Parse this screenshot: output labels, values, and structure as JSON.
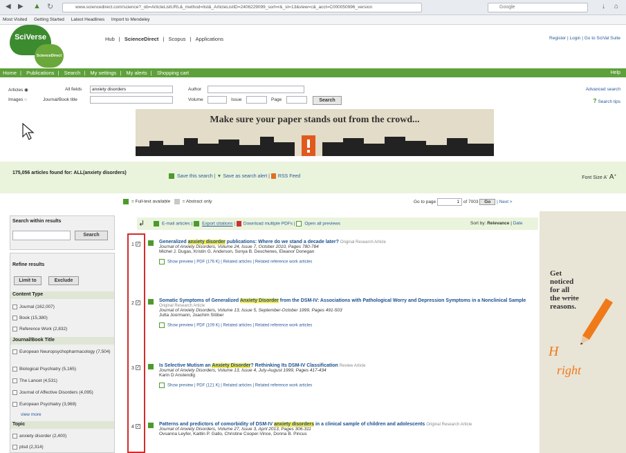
{
  "browser": {
    "url": "www.sciencedirect.com/science?_ob=ArticleListURL&_method=list&_ArticleListID=2406229099_sort=r&_st=13&view=c&_acct=C000050996_version",
    "search_engine": "Google",
    "bookmarks": [
      "Most Visited",
      "Getting Started",
      "Latest Headlines",
      "Import to Mendeley"
    ]
  },
  "header": {
    "logo_main": "SciVerse",
    "logo_sub": "ScienceDirect",
    "topnav": [
      "Hub",
      "ScienceDirect",
      "Scopus",
      "Applications"
    ],
    "right_links": "Register | Login | Go to SciVal Suite"
  },
  "greenbar": {
    "items": [
      "Home",
      "|",
      "Publications",
      "|",
      "Search",
      "|",
      "My settings",
      "|",
      "My alerts",
      "|",
      "Shopping cart"
    ],
    "help": "Help"
  },
  "search_form": {
    "articles_label": "Articles",
    "images_label": "Images",
    "allfields_label": "All fields",
    "allfields_value": "anxiety disorders",
    "journal_label": "Journal/Book title",
    "author_label": "Author",
    "volume_label": "Volume",
    "issue_label": "Issue",
    "page_label": "Page",
    "search_button": "Search",
    "advanced": "Advanced search",
    "tips": "Search tips"
  },
  "ad": {
    "headline": "Make sure your paper stands out from the crowd..."
  },
  "info": {
    "count_prefix": "175,056 articles found for: ALL(",
    "count_query": "anxiety disorders",
    "count_suffix": ")",
    "save_search": "Save this search",
    "save_alert": "Save as search alert",
    "rss": "RSS Feed",
    "font_size": "Font Size"
  },
  "legend": {
    "fulltext": "= Full-text available",
    "abstract": "= Abstract only",
    "goto_label": "Go to page",
    "page_value": "1",
    "of_pages": "of 7003",
    "go": "Go",
    "next": "| Next >"
  },
  "sidebar": {
    "search_within": "Search within results",
    "search_btn": "Search",
    "refine": "Refine results",
    "limit": "Limit to",
    "exclude": "Exclude",
    "content_type": "Content Type",
    "content_items": [
      "Journal (162,007)",
      "Book (15,380)",
      "Reference Work (2,832)"
    ],
    "journal_title": "Journal/Book Title",
    "journal_items": [
      "European Neuropsychopharmacology (7,504)",
      "Biological Psychiatry (5,165)",
      "The Lancet (4,531)",
      "Journal of Affective Disorders (4,095)",
      "European Psychiatry (3,969)"
    ],
    "view_more": "view more",
    "topic": "Topic",
    "topic_items": [
      "anxiety disorder (2,400)",
      "ptsd (2,314)"
    ]
  },
  "results_bar": {
    "email": "E-mail articles",
    "export": "Export citations",
    "download": "Download multiple PDFs",
    "open_previews": "Open all previews",
    "sort_by": "Sort by:",
    "relevance": "Relevance",
    "date": "Date"
  },
  "results": [
    {
      "num": "1",
      "title_a": "Generalized ",
      "title_hl": "anxiety disorder",
      "title_b": " publications: Where do we stand a decade later?",
      "type": "Original Research Article",
      "journal": "Journal of Anxiety Disorders, Volume 24, Issue 7, October 2010, Pages 780-784",
      "authors": "Michel J. Dugas, Kristin G. Anderson, Sonya B. Deschenes, Eleanor Donegan",
      "links": "Show preview | PDF (176 K) | Related articles | Related reference work articles"
    },
    {
      "num": "2",
      "title_a": "Somatic Symptoms of Generalized ",
      "title_hl": "Anxiety Disorder",
      "title_b": " from the DSM-IV: Associations with Pathological Worry and Depression Symptoms in a Nonclinical Sample",
      "type": "Original Research Article",
      "journal": "Journal of Anxiety Disorders, Volume 13, Issue 5, September-October 1999, Pages 491-503",
      "authors": "Jutta Joormann, Joachim Stöber",
      "links": "Show preview | PDF (109 K) | Related articles | Related reference work articles"
    },
    {
      "num": "3",
      "title_a": "Is Selective Mutism an ",
      "title_hl": "Anxiety Disorder",
      "title_b": "? Rethinking Its DSM-IV Classification",
      "type": "Review Article",
      "journal": "Journal of Anxiety Disorders, Volume 13, Issue 4, July-August 1999, Pages 417-434",
      "authors": "Karin D Anstendig",
      "links": "Show preview | PDF (121 K) | Related articles | Related reference work articles"
    },
    {
      "num": "4",
      "title_a": "Patterns and predictors of comorbidity of DSM-IV ",
      "title_hl": "anxiety disorders",
      "title_b": " in a clinical sample of children and adolescents",
      "type": "Original Research Article",
      "journal": "Journal of Anxiety Disorders, Volume 27, Issue 3, April 2013, Pages 306-311",
      "authors": "Ovsanna Leyfer, Kaitlin P. Gallo, Christine Cooper-Vince, Donna B. Pincus",
      "links": ""
    }
  ],
  "right_ad": {
    "text_1": "Get",
    "text_2": "noticed",
    "text_3": "for all",
    "text_4": "the",
    "text_4b": "write",
    "text_5": "reasons.",
    "handwriting": "right"
  },
  "colors": {
    "green": "#5ea03a",
    "highlight": "#f6e94b",
    "red_annotation": "#d32a2a"
  }
}
